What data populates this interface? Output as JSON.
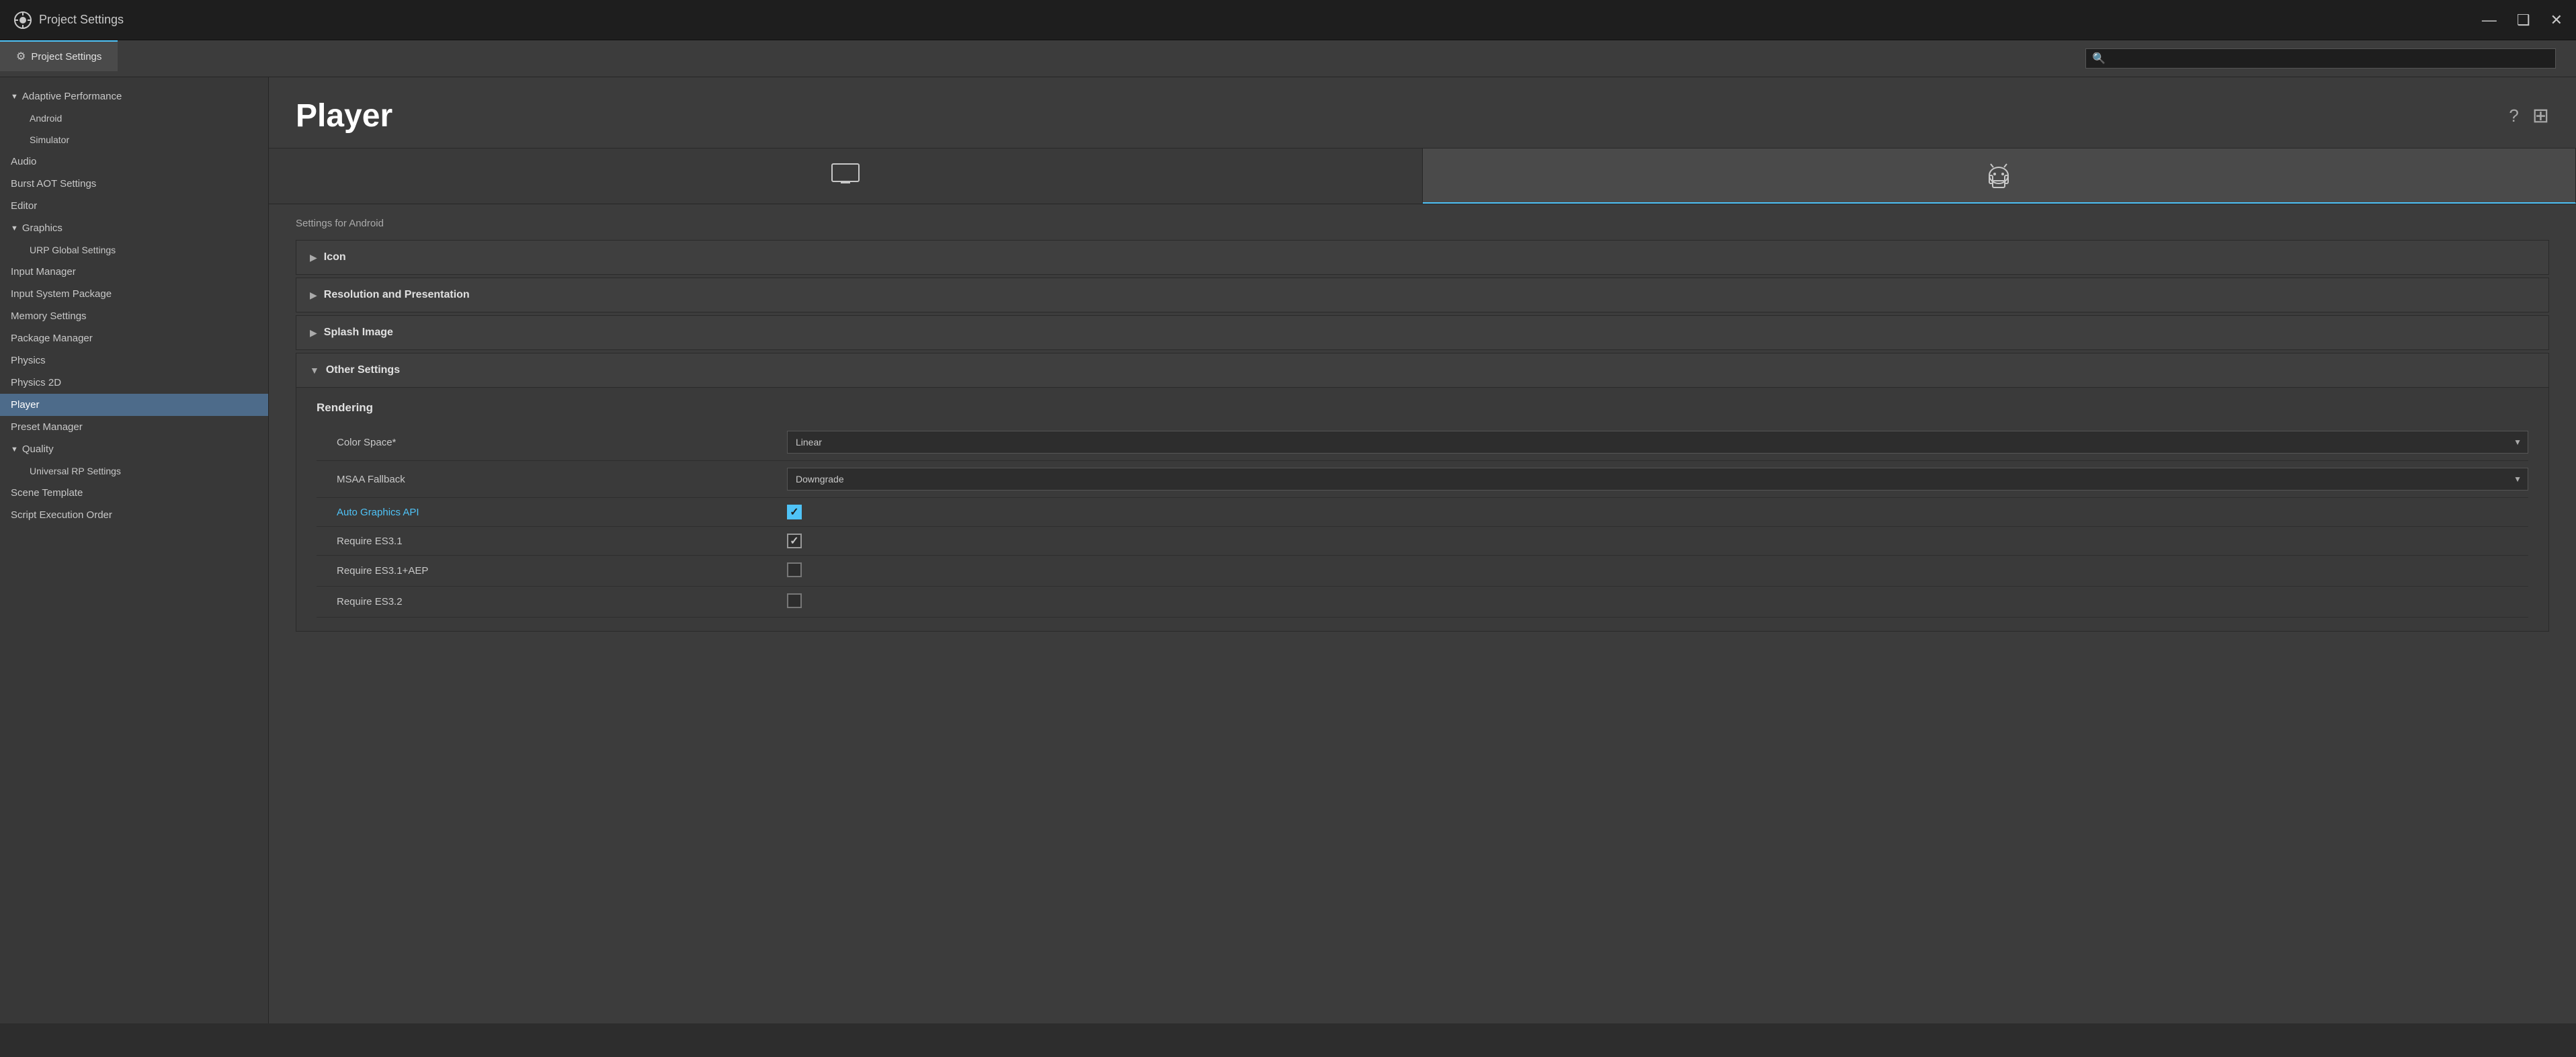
{
  "titleBar": {
    "icon": "⚙",
    "title": "Project Settings",
    "minimizeBtn": "—",
    "maximizeBtn": "❑",
    "closeBtn": "✕"
  },
  "tabBar": {
    "tabs": [
      {
        "icon": "⚙",
        "label": "Project Settings"
      }
    ]
  },
  "search": {
    "placeholder": "",
    "icon": "🔍"
  },
  "sidebar": {
    "items": [
      {
        "type": "parent",
        "arrow": "▼",
        "label": "Adaptive Performance",
        "active": false
      },
      {
        "type": "child",
        "label": "Android",
        "active": false
      },
      {
        "type": "child",
        "label": "Simulator",
        "active": false
      },
      {
        "type": "item",
        "label": "Audio",
        "active": false
      },
      {
        "type": "item",
        "label": "Burst AOT Settings",
        "active": false
      },
      {
        "type": "item",
        "label": "Editor",
        "active": false
      },
      {
        "type": "parent",
        "arrow": "▼",
        "label": "Graphics",
        "active": false
      },
      {
        "type": "child",
        "label": "URP Global Settings",
        "active": false
      },
      {
        "type": "item",
        "label": "Input Manager",
        "active": false
      },
      {
        "type": "item",
        "label": "Input System Package",
        "active": false
      },
      {
        "type": "item",
        "label": "Memory Settings",
        "active": false
      },
      {
        "type": "item",
        "label": "Package Manager",
        "active": false
      },
      {
        "type": "item",
        "label": "Physics",
        "active": false
      },
      {
        "type": "item",
        "label": "Physics 2D",
        "active": false
      },
      {
        "type": "item",
        "label": "Player",
        "active": true
      },
      {
        "type": "item",
        "label": "Preset Manager",
        "active": false
      },
      {
        "type": "parent",
        "arrow": "▼",
        "label": "Quality",
        "active": false
      },
      {
        "type": "child",
        "label": "Universal RP Settings",
        "active": false
      },
      {
        "type": "item",
        "label": "Scene Template",
        "active": false
      },
      {
        "type": "item",
        "label": "Script Execution Order",
        "active": false
      }
    ]
  },
  "content": {
    "title": "Player",
    "helpIcon": "?",
    "layoutIcon": "⊞",
    "settingsFor": "Settings for Android",
    "platformTabs": [
      {
        "icon": "🖥",
        "active": false
      },
      {
        "icon": "🤖",
        "active": true
      }
    ],
    "sections": [
      {
        "label": "Icon",
        "collapsed": true
      },
      {
        "label": "Resolution and Presentation",
        "collapsed": true
      },
      {
        "label": "Splash Image",
        "collapsed": true
      },
      {
        "label": "Other Settings",
        "collapsed": false
      }
    ],
    "otherSettings": {
      "subsections": [
        {
          "title": "Rendering",
          "rows": [
            {
              "label": "Color Space*",
              "type": "dropdown",
              "value": "Linear",
              "link": false
            },
            {
              "label": "MSAA Fallback",
              "type": "dropdown",
              "value": "Downgrade",
              "link": false
            },
            {
              "label": "Auto Graphics API",
              "type": "checkbox",
              "checked": true,
              "link": true
            },
            {
              "label": "Require ES3.1",
              "type": "checkbox",
              "checked": true,
              "link": false
            },
            {
              "label": "Require ES3.1+AEP",
              "type": "checkbox",
              "checked": false,
              "link": false
            },
            {
              "label": "Require ES3.2",
              "type": "checkbox",
              "checked": false,
              "link": false
            }
          ]
        }
      ]
    }
  }
}
